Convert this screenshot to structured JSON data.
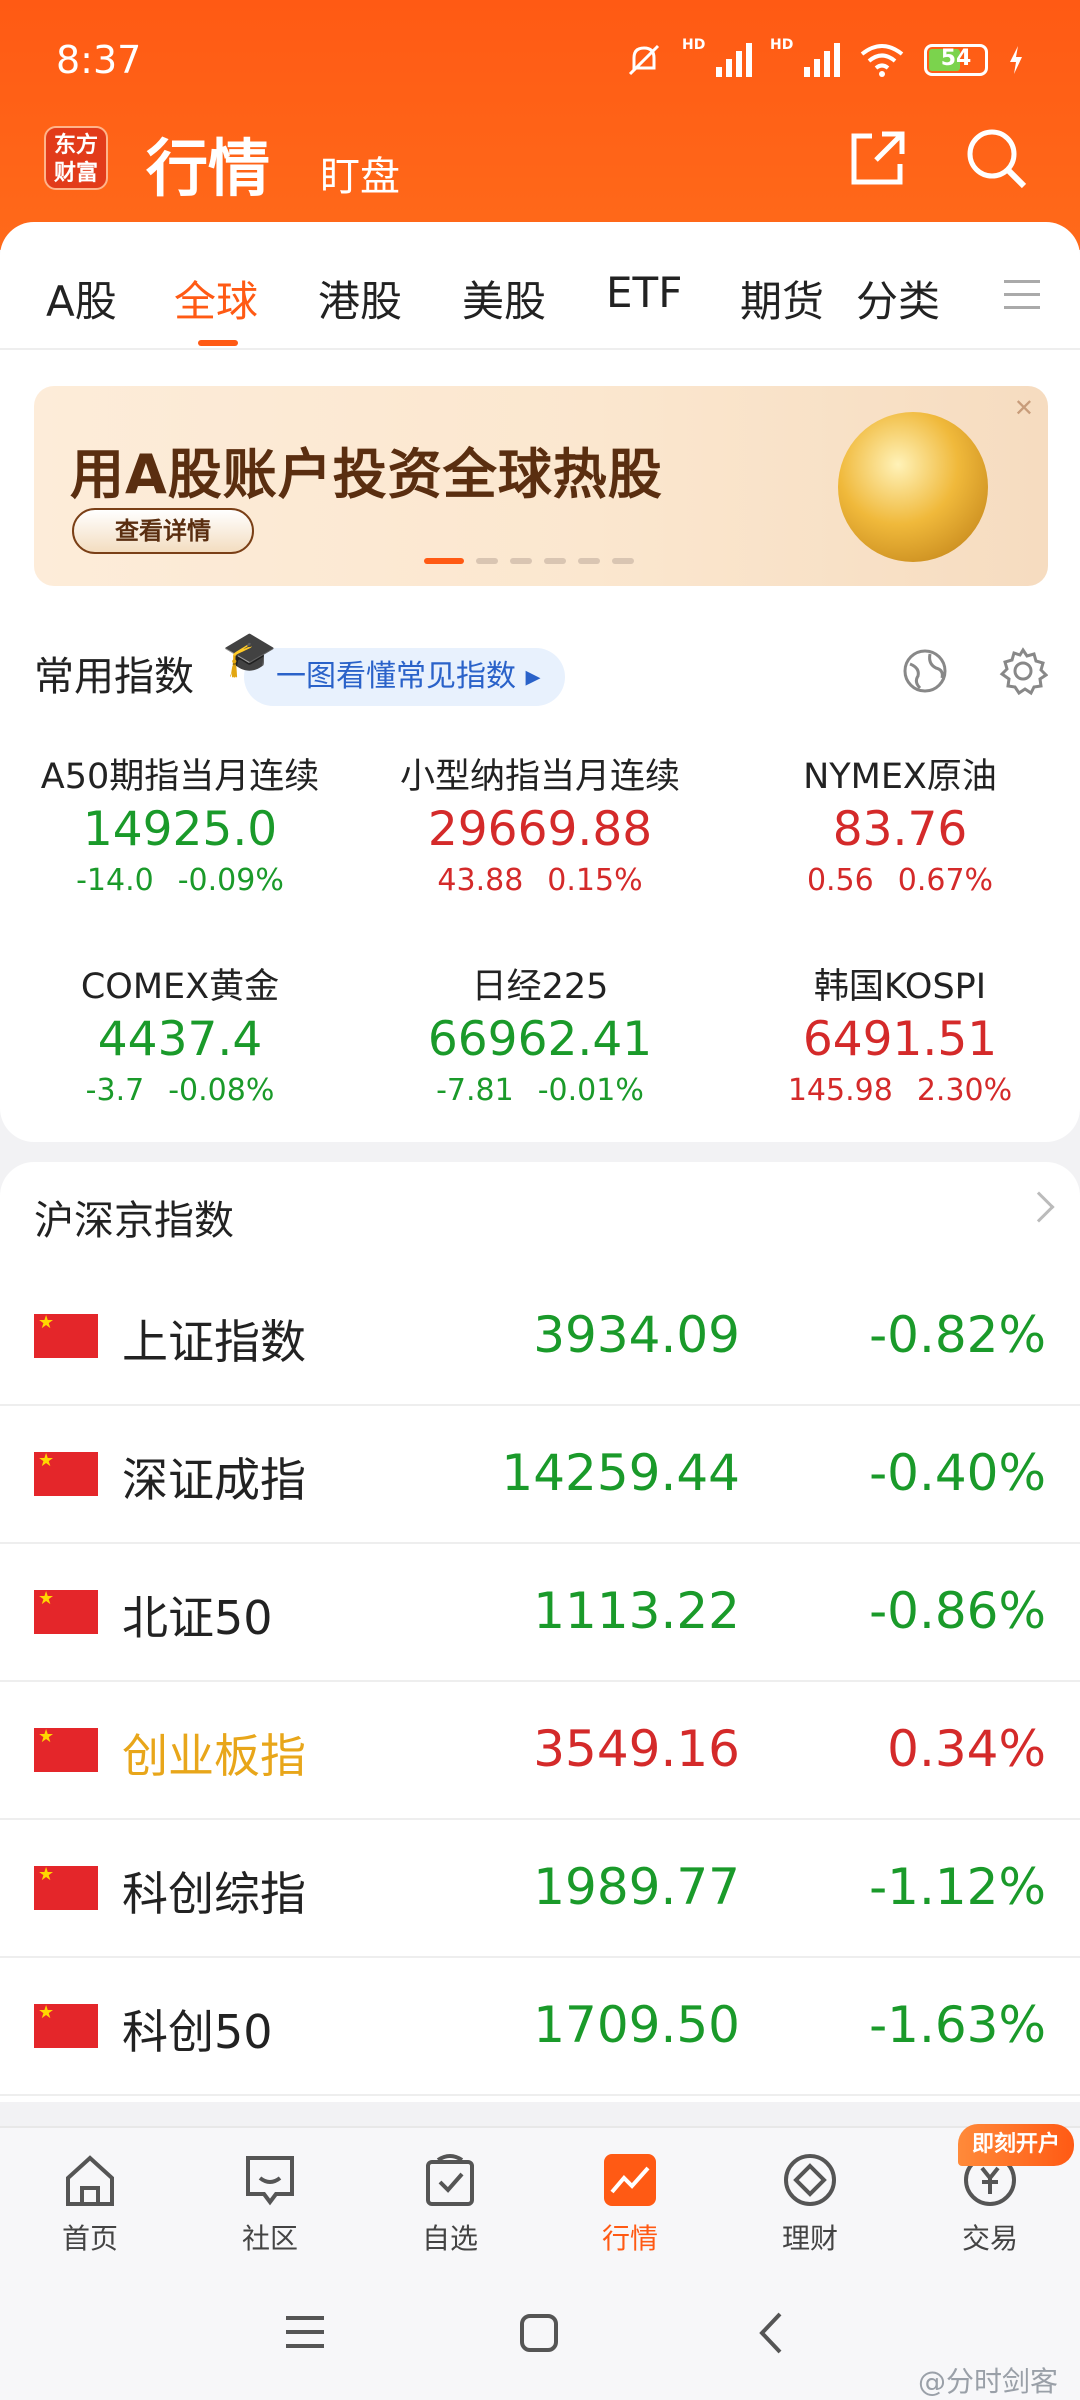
{
  "status": {
    "time": "8:37",
    "battery": "54"
  },
  "header": {
    "logo_line1": "东方",
    "logo_line2": "财富",
    "title": "行情",
    "subtitle": "盯盘"
  },
  "tabs": [
    {
      "label": "A股"
    },
    {
      "label": "全球"
    },
    {
      "label": "港股"
    },
    {
      "label": "美股"
    },
    {
      "label": "ETF"
    },
    {
      "label": "期货"
    },
    {
      "label": "分类"
    }
  ],
  "banner": {
    "headline": "用A股账户投资全球热股",
    "button": "查看详情"
  },
  "common_indices": {
    "title": "常用指数",
    "guide_link": "一图看懂常见指数 ▸",
    "items": [
      {
        "name": "A50期指当月连续",
        "value": "14925.0",
        "chg": "-14.0",
        "pct": "-0.09%",
        "dir": "dn"
      },
      {
        "name": "小型纳指当月连续",
        "value": "29669.88",
        "chg": "43.88",
        "pct": "0.15%",
        "dir": "up"
      },
      {
        "name": "NYMEX原油",
        "value": "83.76",
        "chg": "0.56",
        "pct": "0.67%",
        "dir": "up"
      },
      {
        "name": "COMEX黄金",
        "value": "4437.4",
        "chg": "-3.7",
        "pct": "-0.08%",
        "dir": "dn"
      },
      {
        "name": "日经225",
        "value": "66962.41",
        "chg": "-7.81",
        "pct": "-0.01%",
        "dir": "dn"
      },
      {
        "name": "韩国KOSPI",
        "value": "6491.51",
        "chg": "145.98",
        "pct": "2.30%",
        "dir": "up"
      }
    ]
  },
  "domestic": {
    "title": "沪深京指数",
    "rows": [
      {
        "name": "上证指数",
        "price": "3934.09",
        "pct": "-0.82%",
        "dir": "dn"
      },
      {
        "name": "深证成指",
        "price": "14259.44",
        "pct": "-0.40%",
        "dir": "dn"
      },
      {
        "name": "北证50",
        "price": "1113.22",
        "pct": "-0.86%",
        "dir": "dn"
      },
      {
        "name": "创业板指",
        "price": "3549.16",
        "pct": "0.34%",
        "dir": "up"
      },
      {
        "name": "科创综指",
        "price": "1989.77",
        "pct": "-1.12%",
        "dir": "dn"
      },
      {
        "name": "科创50",
        "price": "1709.50",
        "pct": "-1.63%",
        "dir": "dn"
      }
    ]
  },
  "bottom_nav": [
    {
      "label": "首页"
    },
    {
      "label": "社区"
    },
    {
      "label": "自选"
    },
    {
      "label": "行情"
    },
    {
      "label": "理财"
    },
    {
      "label": "交易"
    }
  ],
  "badge": "即刻开户",
  "watermark": "@分时剑客",
  "colors": {
    "brand": "#ff5a14",
    "up": "#d42a2a",
    "down": "#1a9a2a",
    "highlight": "#e8a61a"
  }
}
